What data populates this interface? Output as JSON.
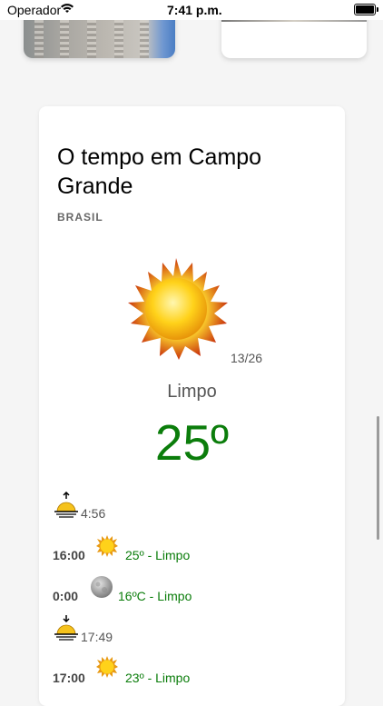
{
  "status_bar": {
    "carrier": "Operador",
    "time": "7:41 p.m."
  },
  "weather": {
    "title": "O tempo em Campo Grande",
    "country": "BRASIL",
    "min_max": "13/26",
    "condition": "Limpo",
    "temperature": "25º",
    "sunrise": {
      "time": "4:56"
    },
    "forecast": [
      {
        "time": "16:00",
        "desc": "25º - Limpo",
        "icon": "sun-icon"
      },
      {
        "time": "0:00",
        "desc": "16ºC - Limpo",
        "icon": "moon-icon"
      }
    ],
    "sunset": {
      "time": "17:49"
    },
    "forecast_after": {
      "time": "17:00",
      "desc": "23º - Limpo",
      "icon": "sun-icon"
    }
  },
  "colors": {
    "temp": "#0b7d0b",
    "card_bg": "#ffffff",
    "page_bg": "#f5f5f5"
  }
}
